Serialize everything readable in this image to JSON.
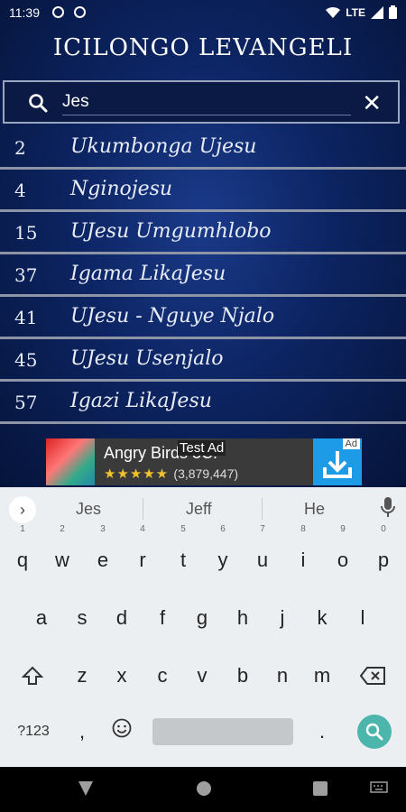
{
  "status": {
    "time": "11:39",
    "network": "LTE"
  },
  "app": {
    "title": "ICILONGO LEVANGELI"
  },
  "search": {
    "value": "Jes",
    "clear_label": "✕"
  },
  "results": [
    {
      "num": "2",
      "title": "Ukumbonga Ujesu"
    },
    {
      "num": "4",
      "title": "Nginojesu"
    },
    {
      "num": "15",
      "title": "UJesu Umgumhlobo"
    },
    {
      "num": "37",
      "title": "Igama LikaJesu"
    },
    {
      "num": "41",
      "title": "UJesu - Nguye Njalo"
    },
    {
      "num": "45",
      "title": "UJesu Usenjalo"
    },
    {
      "num": "57",
      "title": "Igazi LikaJesu"
    }
  ],
  "ad": {
    "app_name": "Angry Birds 3C.",
    "badge": "Test Ad",
    "stars": "★★★★★",
    "reviews": "(3,879,447)",
    "ad_tag": "Ad"
  },
  "keyboard": {
    "suggestions": [
      "Jes",
      "Jeff",
      "He"
    ],
    "row1": [
      "q",
      "w",
      "e",
      "r",
      "t",
      "y",
      "u",
      "i",
      "o",
      "p"
    ],
    "row1_hints": [
      "1",
      "2",
      "3",
      "4",
      "5",
      "6",
      "7",
      "8",
      "9",
      "0"
    ],
    "row2": [
      "a",
      "s",
      "d",
      "f",
      "g",
      "h",
      "j",
      "k",
      "l"
    ],
    "row3": [
      "z",
      "x",
      "c",
      "v",
      "b",
      "n",
      "m"
    ],
    "symbols_label": "?123",
    "comma": ",",
    "period": "."
  }
}
